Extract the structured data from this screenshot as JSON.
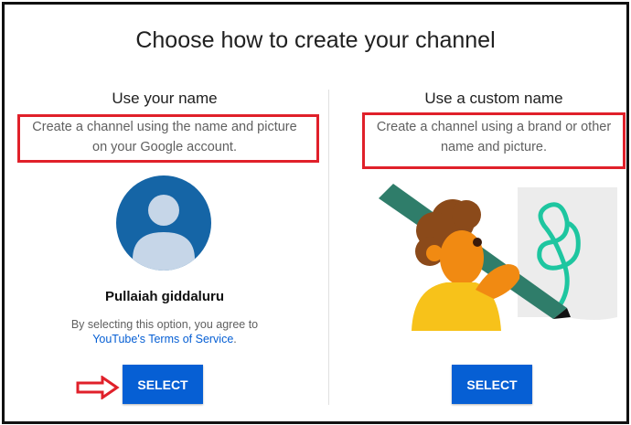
{
  "dialog": {
    "title": "Choose how to create your channel"
  },
  "left_option": {
    "heading": "Use your name",
    "description_line1": "Create a channel using the name and picture",
    "description_line2": "on your Google account.",
    "user_name": "Pullaiah giddaluru",
    "agreement_text": "By selecting this option, you agree to",
    "terms_link": "YouTube's Terms of Service",
    "terms_suffix": ".",
    "button_label": "SELECT"
  },
  "right_option": {
    "heading": "Use a custom name",
    "description_line1": "Create a channel using a brand or other",
    "description_line2": "name and picture.",
    "button_label": "SELECT"
  },
  "colors": {
    "accent_blue": "#065fd4",
    "highlight_red": "#e0202a",
    "avatar_blue": "#1565a6"
  }
}
